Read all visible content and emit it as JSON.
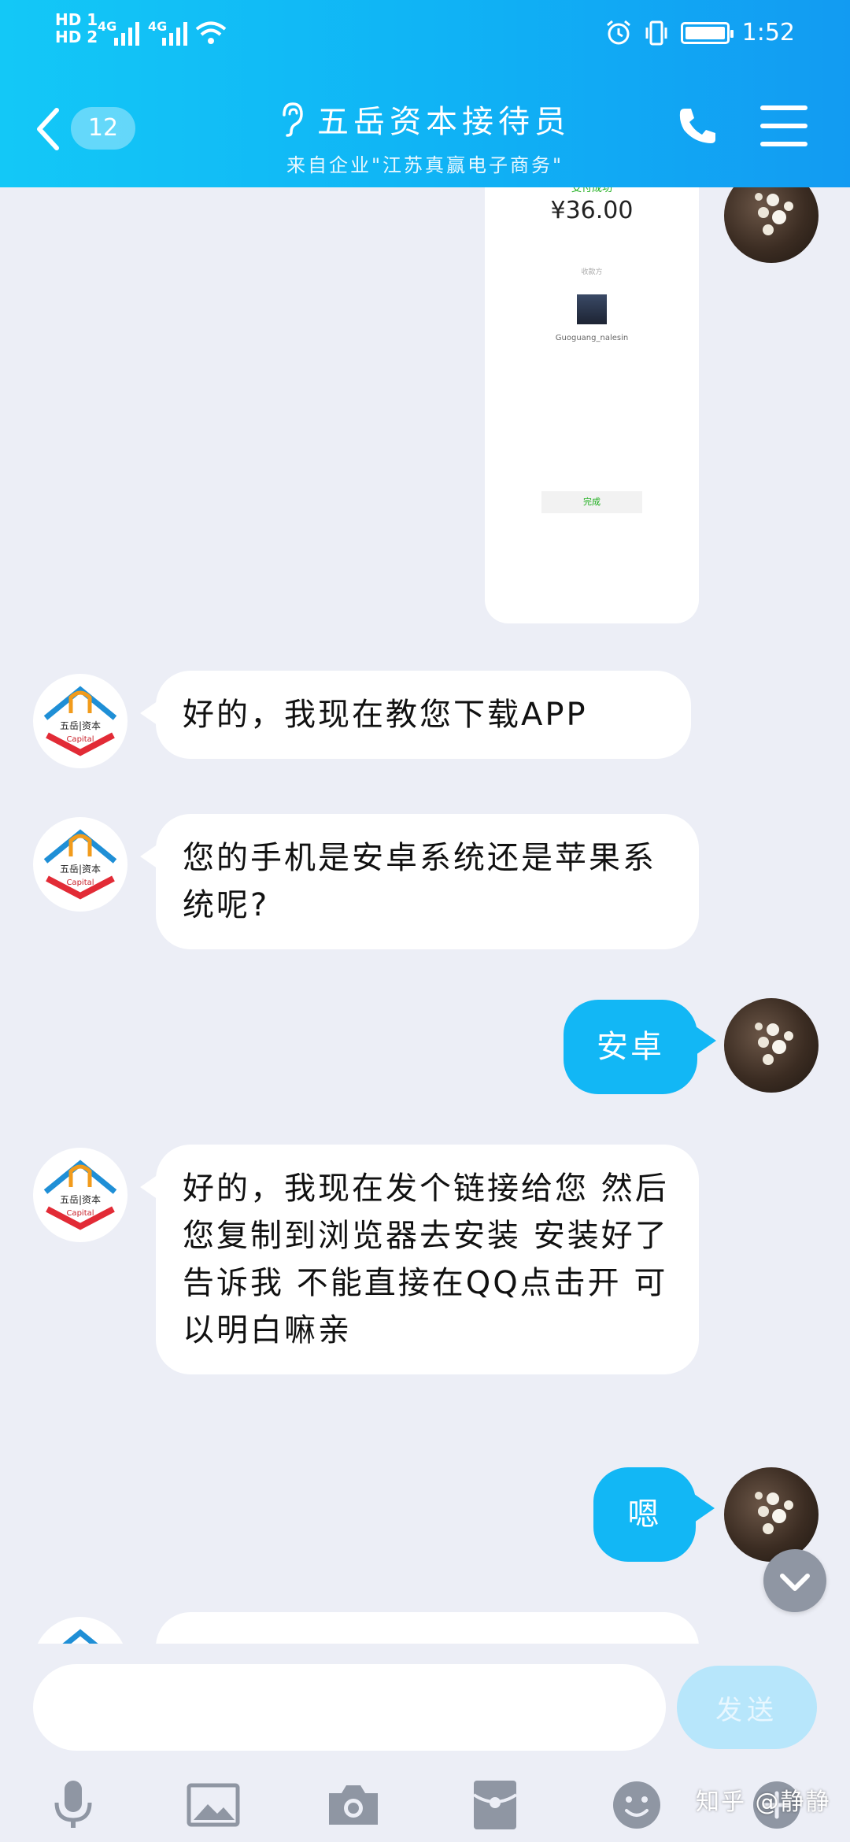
{
  "status_bar": {
    "left_line1": "HD 1",
    "left_line2": "HD 2",
    "net1": "4G",
    "net2": "4G",
    "time": "1:52"
  },
  "header": {
    "unread_count": "12",
    "title": "五岳资本接待员",
    "subtitle": "来自企业\"江苏真赢电子商务\"",
    "accent_color": "#12b7f5"
  },
  "messages": [
    {
      "side": "out",
      "type": "image",
      "payment": {
        "title": "支付成功",
        "amount": "¥36.00",
        "label": "收款方",
        "user": "Guoguang_nalesin",
        "button": "完成"
      }
    },
    {
      "side": "in",
      "text": "好的，我现在教您下载APP"
    },
    {
      "side": "in",
      "text": "您的手机是安卓系统还是苹果系统呢?"
    },
    {
      "side": "out",
      "text": "安卓"
    },
    {
      "side": "in",
      "text": "好的，我现在发个链接给您 然后您复制到浏览器去安装 安装好了告诉我 不能直接在QQ点击开 可以明白嘛亲"
    },
    {
      "side": "out",
      "text": "嗯"
    }
  ],
  "avatar_logo": {
    "text": "五岳|资本",
    "sub": "Capital"
  },
  "input": {
    "placeholder": "",
    "send_label": "发送"
  },
  "toolbar": [
    "mic-icon",
    "image-icon",
    "camera-icon",
    "red-packet-icon",
    "emoji-icon",
    "plus-icon"
  ],
  "watermark": "知乎 @静静"
}
